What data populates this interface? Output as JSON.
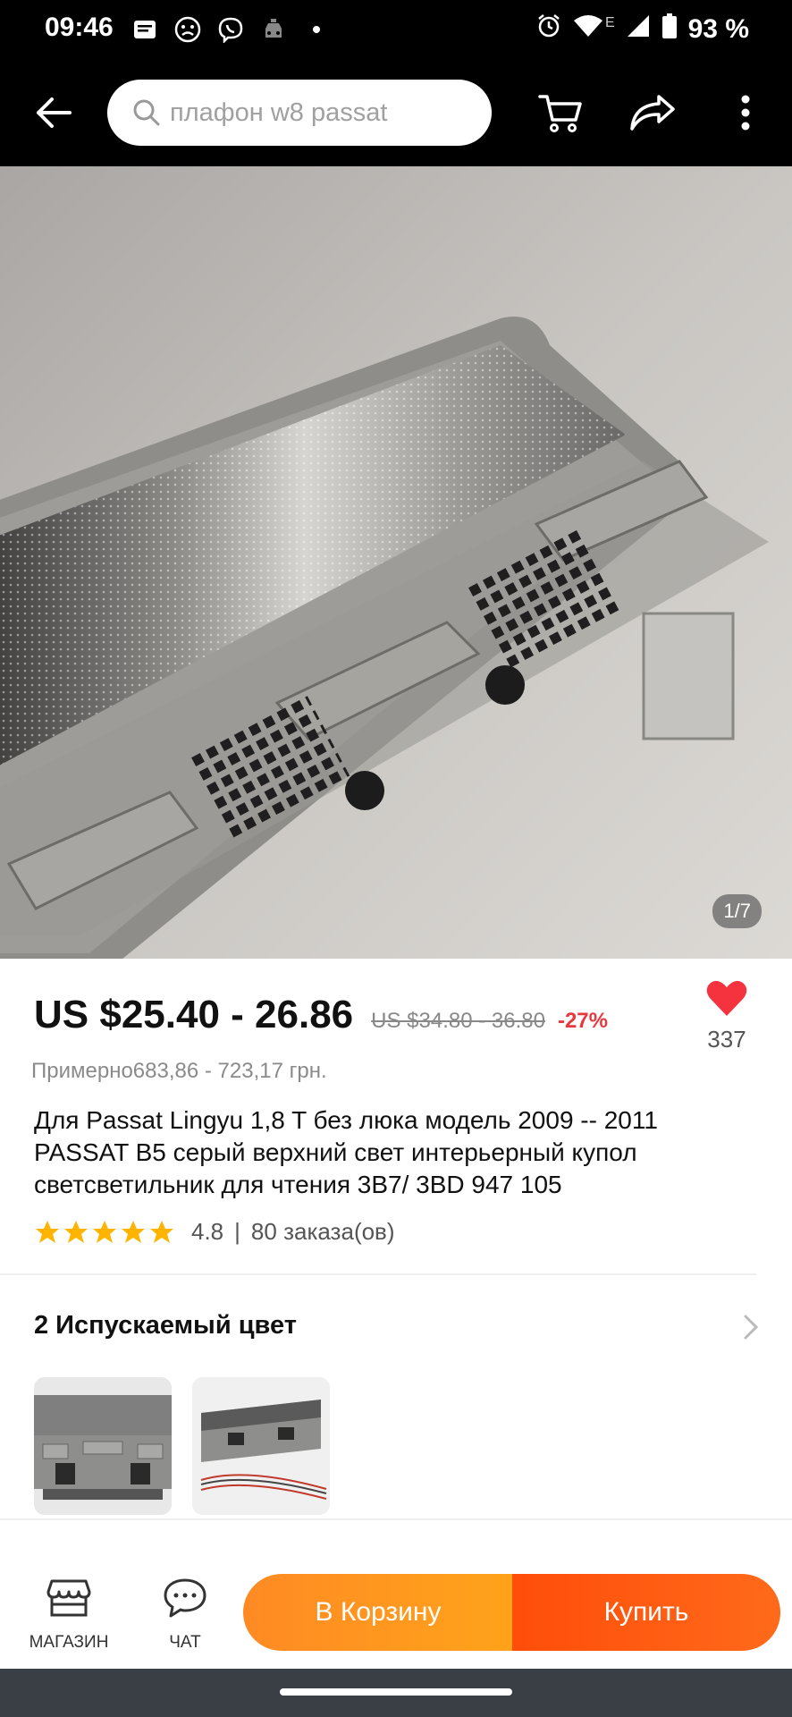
{
  "status_bar": {
    "time": "09:46",
    "battery": "93 %",
    "network": "E"
  },
  "search": {
    "placeholder": "плафон w8 passat"
  },
  "gallery": {
    "pager": "1/7"
  },
  "product": {
    "price": "US $25.40 - 26.86",
    "old_price": "US $34.80 - 36.80",
    "discount": "-27%",
    "approx_price": "Примерно683,86 - 723,17 грн.",
    "title": "Для Passat Lingyu 1,8 T без люка модель 2009 -- 2011 PASSAT B5 серый верхний свет интерьерный купол светсветильник для чтения 3B7/ 3BD 947 105",
    "rating": "4.8",
    "orders": "80 заказа(ов)",
    "favorites": "337",
    "stars": 5
  },
  "variants": {
    "title": "2 Испускаемый цвет"
  },
  "bottom_bar": {
    "store_label": "МАГАЗИН",
    "chat_label": "ЧАТ",
    "cart_label": "В Корзину",
    "buy_label": "Купить"
  },
  "colors": {
    "accent_orange": "#ff9a1f",
    "accent_red": "#ff5210",
    "heart": "#f5333f",
    "discount": "#e8383d"
  }
}
